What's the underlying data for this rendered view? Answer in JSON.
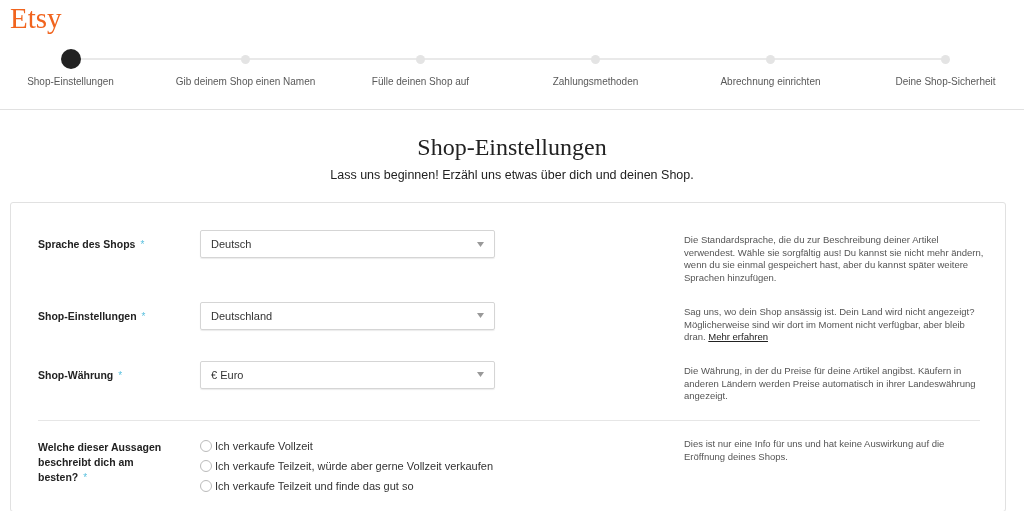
{
  "logo": "Etsy",
  "steps": [
    {
      "label": "Shop-Einstellungen",
      "selected": true
    },
    {
      "label": "Gib deinem Shop einen Namen",
      "selected": false
    },
    {
      "label": "Fülle deinen Shop auf",
      "selected": false
    },
    {
      "label": "Zahlungsmethoden",
      "selected": false
    },
    {
      "label": "Abrechnung einrichten",
      "selected": false
    },
    {
      "label": "Deine Shop-Sicherheit",
      "selected": false
    }
  ],
  "heading": "Shop-Einstellungen",
  "subheading": "Lass uns beginnen! Erzähl uns etwas über dich und deinen Shop.",
  "fields": [
    {
      "label": "Sprache des Shops",
      "required_mark": "*",
      "value": "Deutsch",
      "help": "Die Standardsprache, die du zur Beschreibung deiner Artikel verwendest. Wähle sie sorgfältig aus! Du kannst sie nicht mehr ändern, wenn du sie einmal gespeichert hast, aber du kannst später weitere Sprachen hinzufügen."
    },
    {
      "label": "Shop-Einstellungen",
      "required_mark": "*",
      "value": "Deutschland",
      "help": "Sag uns, wo dein Shop ansässig ist. Dein Land wird nicht angezeigt? Möglicherweise sind wir dort im Moment nicht verfügbar, aber bleib dran.",
      "help_link": "Mehr erfahren"
    },
    {
      "label": "Shop-Währung",
      "required_mark": "*",
      "value": "€ Euro",
      "help": "Die Währung, in der du Preise für deine Artikel angibst. Käufern in anderen Ländern werden Preise automatisch in ihrer Landeswährung angezeigt."
    }
  ],
  "question": {
    "label": "Welche dieser Aussagen beschreibt dich am besten?",
    "required_mark": "*",
    "help": "Dies ist nur eine Info für uns und hat keine Auswirkung auf die Eröffnung deines Shops.",
    "options": [
      {
        "label": "Ich verkaufe Vollzeit",
        "selected": false
      },
      {
        "label": "Ich verkaufe Teilzeit, würde aber gerne Vollzeit verkaufen",
        "selected": false
      },
      {
        "label": "Ich verkaufe Teilzeit und finde das gut so",
        "selected": false
      }
    ]
  }
}
